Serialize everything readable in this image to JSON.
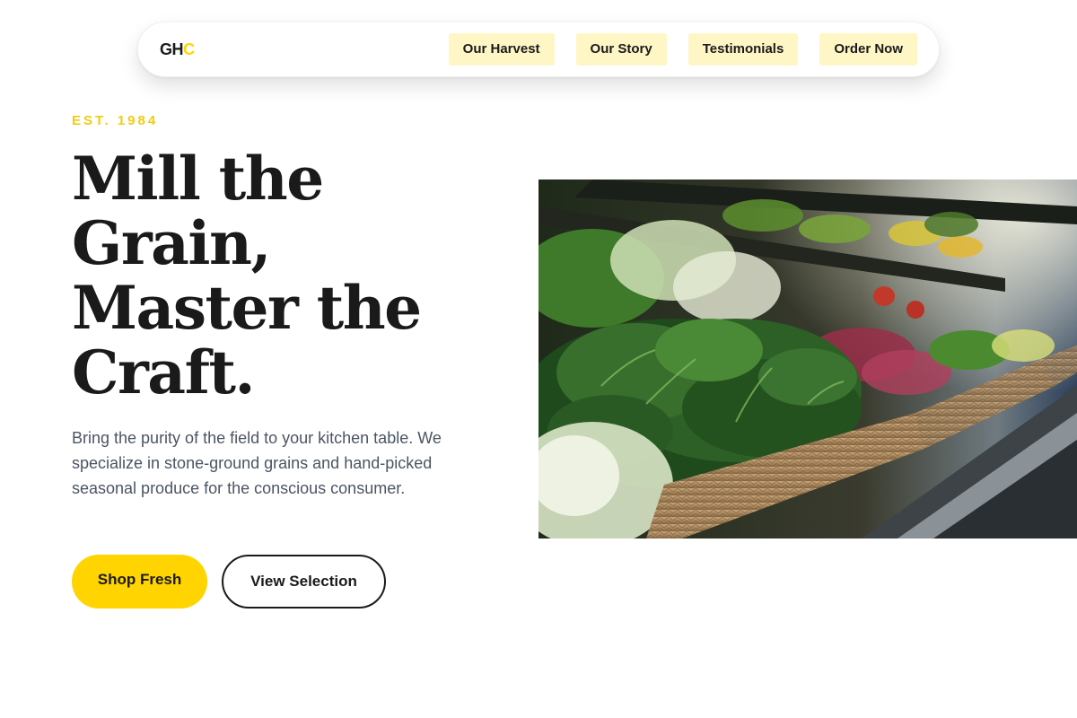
{
  "nav": {
    "logo_main": "GH",
    "logo_accent": "C",
    "links": [
      {
        "label": "Our Harvest"
      },
      {
        "label": "Our Story"
      },
      {
        "label": "Testimonials"
      },
      {
        "label": "Order Now"
      }
    ]
  },
  "hero": {
    "eyebrow": "EST. 1984",
    "headline": "Mill the Grain, Master the Craft.",
    "description": "Bring the purity of the field to your kitchen table. We specialize in stone-ground grains and hand-picked seasonal produce for the conscious consumer.",
    "primary_cta": "Shop Fresh",
    "secondary_cta": "View Selection",
    "image_subject": "fresh leafy greens in wicker baskets on grocery shelves"
  },
  "colors": {
    "accent": "#ffd400",
    "nav_link_bg": "#fff6c6",
    "text_dark": "#1a1a1a",
    "text_muted": "#4b5563"
  }
}
